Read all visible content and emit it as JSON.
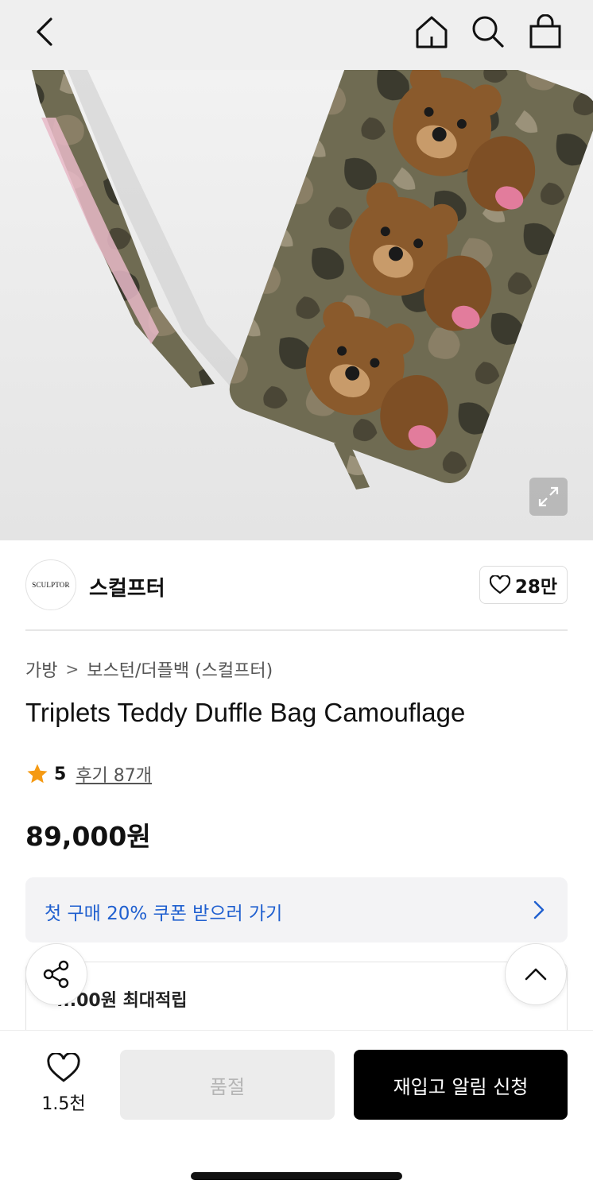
{
  "header": {
    "back_icon": "chevron-left-icon",
    "home_icon": "home-icon",
    "search_icon": "search-icon",
    "cart_icon": "shopping-bag-icon"
  },
  "hero": {
    "expand_icon": "expand-icon"
  },
  "brand": {
    "logo_text": "SCULPTOR",
    "name": "스컬프터",
    "likes": "28만"
  },
  "breadcrumb": {
    "category": "가방",
    "separator": ">",
    "subcategory": "보스턴/더플백 (스컬프터)"
  },
  "product": {
    "title": "Triplets Teddy Duffle Bag Camouflage",
    "rating": "5",
    "reviews": "후기 87개",
    "price": "89,000원"
  },
  "coupon": {
    "text": "첫 구매 20% 쿠폰 받으러 가기"
  },
  "points": {
    "text": "...00원 최대적립"
  },
  "bottom": {
    "wish_count": "1.5천",
    "soldout_label": "품절",
    "restock_label": "재입고 알림 신청"
  },
  "colors": {
    "accent_blue": "#1f5fcf",
    "star": "#f59a13",
    "primary_button": "#000000"
  }
}
